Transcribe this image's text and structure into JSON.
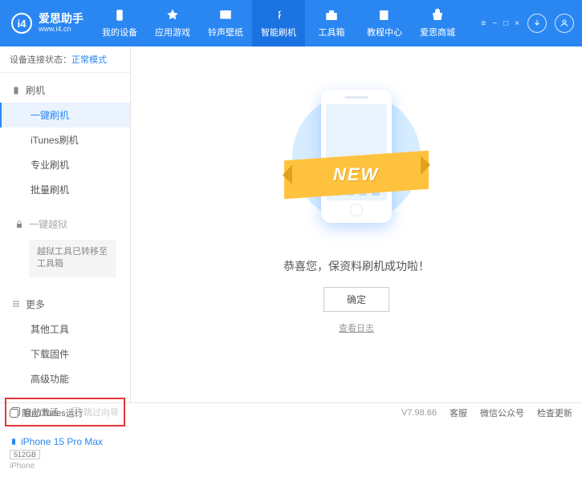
{
  "header": {
    "logo_title": "爱思助手",
    "logo_url": "www.i4.cn",
    "nav": [
      {
        "label": "我的设备"
      },
      {
        "label": "应用游戏"
      },
      {
        "label": "铃声壁纸"
      },
      {
        "label": "智能刷机",
        "active": true
      },
      {
        "label": "工具箱"
      },
      {
        "label": "教程中心"
      },
      {
        "label": "爱思商城"
      }
    ],
    "window_buttons": [
      "≡",
      "−",
      "□",
      "×"
    ]
  },
  "sidebar": {
    "conn_status_label": "设备连接状态：",
    "conn_status_value": "正常模式",
    "flash": {
      "title": "刷机",
      "items": [
        {
          "label": "一键刷机",
          "active": true
        },
        {
          "label": "iTunes刷机"
        },
        {
          "label": "专业刷机"
        },
        {
          "label": "批量刷机"
        }
      ]
    },
    "jailbreak": {
      "title": "一键越狱",
      "note": "越狱工具已转移至工具箱"
    },
    "more": {
      "title": "更多",
      "items": [
        "其他工具",
        "下载固件",
        "高级功能"
      ]
    },
    "checkboxes": {
      "auto_activate": "自动激活",
      "skip_guide": "跳过向导"
    },
    "device": {
      "name": "iPhone 15 Pro Max",
      "capacity": "512GB",
      "type": "iPhone"
    }
  },
  "main": {
    "ribbon": "NEW",
    "success_text": "恭喜您，保资料刷机成功啦！",
    "ok_button": "确定",
    "log_link": "查看日志"
  },
  "footer": {
    "block_itunes": "阻止iTunes运行",
    "version": "V7.98.66",
    "links": [
      "客服",
      "微信公众号",
      "检查更新"
    ]
  }
}
